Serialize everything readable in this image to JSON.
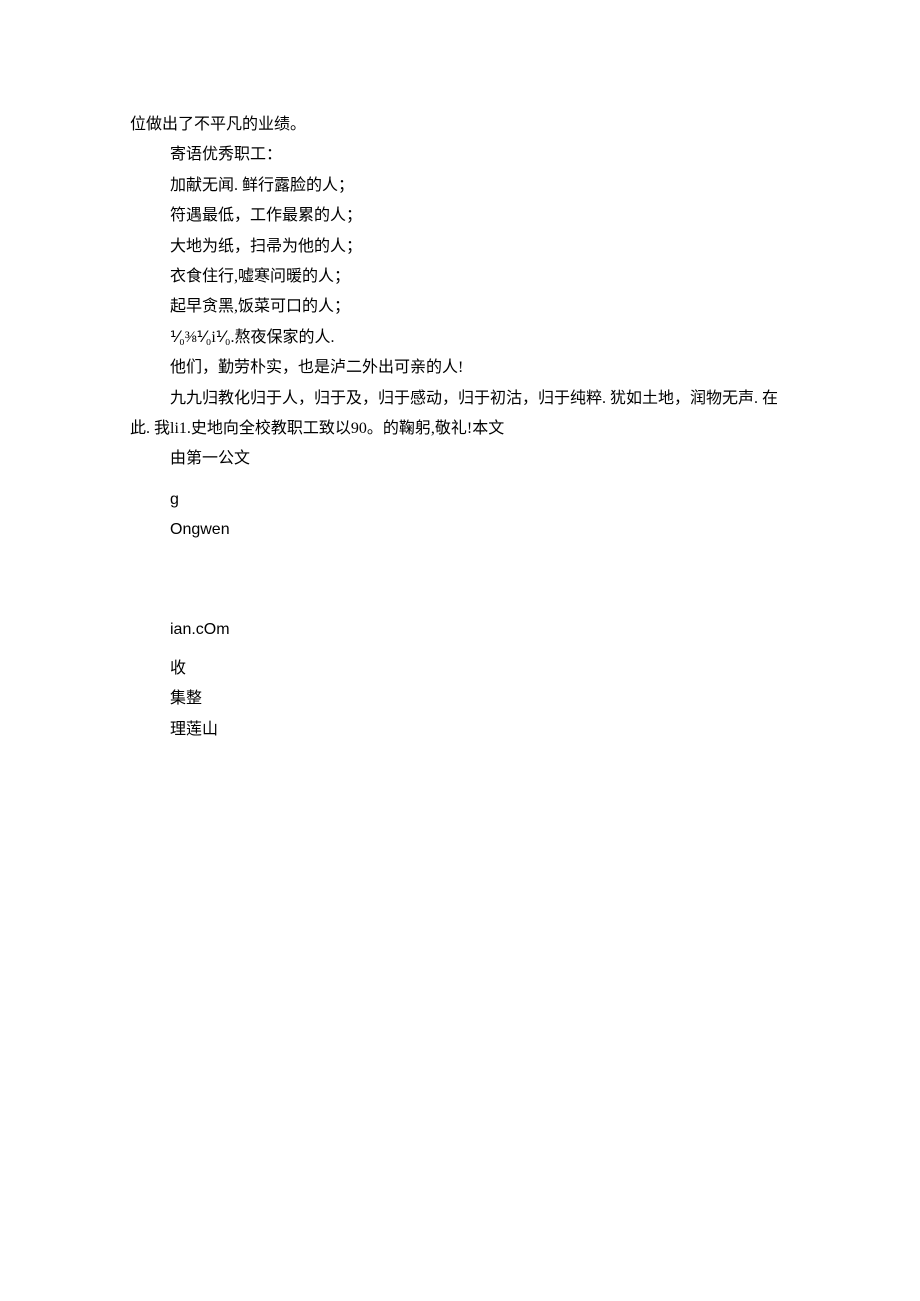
{
  "lines": [
    {
      "text": "位做出了不平凡的业绩。",
      "indent": false
    },
    {
      "text": "寄语优秀职工：",
      "indent": true
    },
    {
      "text": "加献无闻. 鲜行露脸的人；",
      "indent": true
    },
    {
      "text": "符遇最低，工作最累的人；",
      "indent": true
    },
    {
      "text": "大地为纸，扫帚为他的人；",
      "indent": true
    },
    {
      "text": "衣食住行,嘘寒问暖的人；",
      "indent": true
    },
    {
      "text": "起早贪黑,饭菜可口的人；",
      "indent": true
    },
    {
      "text": "⅟₀⅜⅟₀i⅟₀.熬夜保家的人.",
      "indent": true
    },
    {
      "text": "他们，勤劳朴实，也是泸二外出可亲的人!",
      "indent": true
    },
    {
      "text": "九九归教化归于人，归于及，归于感动，归于初沽，归于纯粹. 犹如土地，润物无声. 在",
      "indent": true
    },
    {
      "text": "此. 我li1.史地向全校教职工致以90。的鞠躬,敬礼!本文",
      "indent": false
    },
    {
      "text": "由第一公文",
      "indent": true
    }
  ],
  "latin_block_1": {
    "line1": "g",
    "line2": "Ongwen"
  },
  "latin_block_2": {
    "line1": "ian.cOm"
  },
  "tail_lines": [
    {
      "text": "收",
      "indent": true
    },
    {
      "text": "集整",
      "indent": true
    },
    {
      "text": "理莲山",
      "indent": true
    }
  ]
}
